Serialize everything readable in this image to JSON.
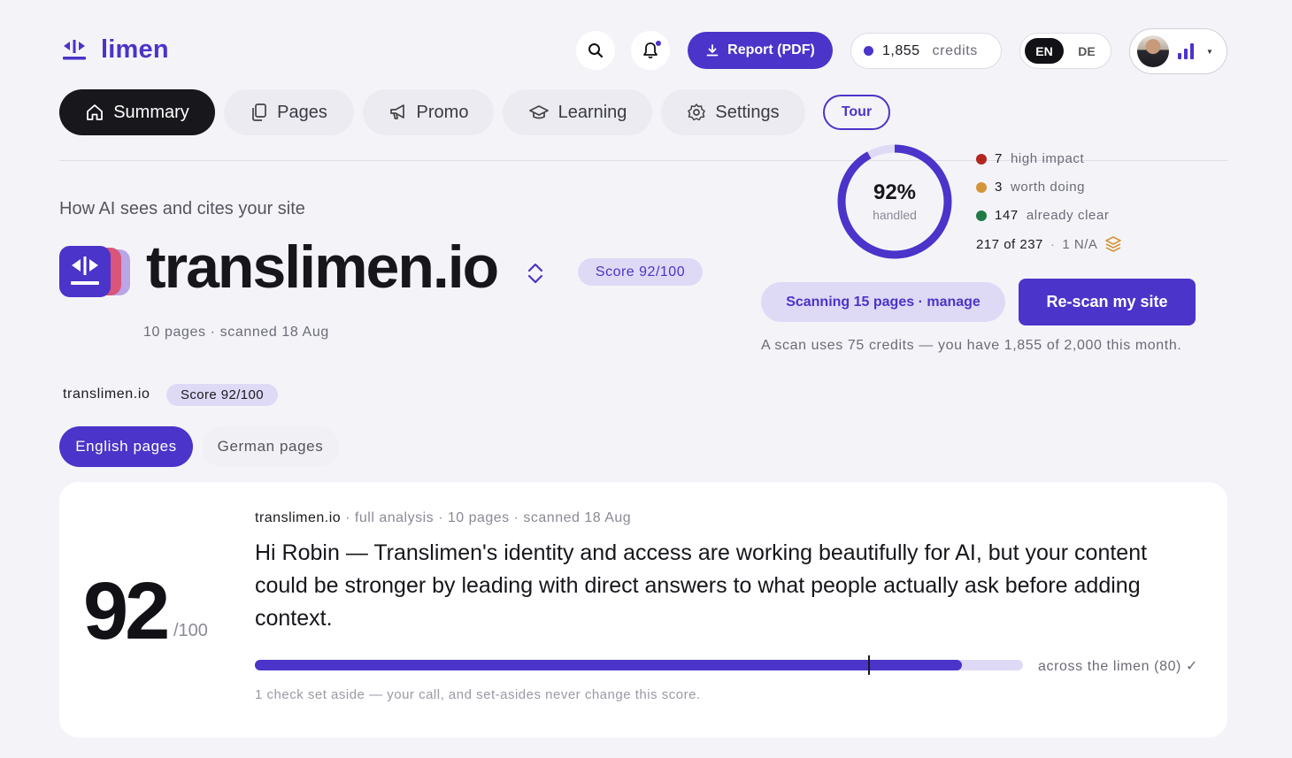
{
  "header": {
    "brand": "limen",
    "report_label": "Report (PDF)",
    "credits": {
      "amount": "1,855",
      "label": "credits"
    },
    "languages": [
      {
        "code": "EN",
        "active": true
      },
      {
        "code": "DE",
        "active": false
      }
    ]
  },
  "tabs": [
    {
      "label": "Summary",
      "icon": "home-icon",
      "active": true
    },
    {
      "label": "Pages",
      "icon": "pages-icon",
      "active": false
    },
    {
      "label": "Promo",
      "icon": "megaphone-icon",
      "active": false
    },
    {
      "label": "Learning",
      "icon": "graduation-cap-icon",
      "active": false
    },
    {
      "label": "Settings",
      "icon": "gear-icon",
      "active": false
    }
  ],
  "tour_label": "Tour",
  "hero": {
    "subtitle": "How AI sees and cites your site",
    "site": "translimen.io",
    "score": "Score 92/100",
    "meta": "10 pages · scanned 18 Aug"
  },
  "status": {
    "handled_percent": 92,
    "handled_text": "92%",
    "handled_label": "handled",
    "legend": [
      {
        "count": "7",
        "label": "high impact",
        "color": "#b3261e"
      },
      {
        "count": "3",
        "label": "worth doing",
        "color": "#d4943a"
      },
      {
        "count": "147",
        "label": "already clear",
        "color": "#1f7a45"
      }
    ],
    "totals": "217 of 237",
    "na": "1 N/A",
    "scan_pill": "Scanning 15 pages · manage",
    "rescan": "Re-scan my site",
    "note": "A scan uses 75 credits — you have 1,855 of 2,000 this month."
  },
  "secondary": {
    "domain": "translimen.io",
    "score": "Score 92/100",
    "lang_tabs": [
      {
        "label": "English pages",
        "active": true
      },
      {
        "label": "German pages",
        "active": false
      }
    ]
  },
  "card": {
    "score": "92",
    "score_of": "/100",
    "meta_domain": "translimen.io",
    "meta_rest": " · full analysis · 10 pages · scanned 18 Aug",
    "message": "Hi Robin — Translimen's identity and access are working beautifully for AI, but your content could be stronger by leading with direct answers to what people actually ask before adding context.",
    "bar_value": 92,
    "benchmark_value": 80,
    "bar_caption": "across the limen (80) ✓",
    "footnote": "1 check set aside — your call, and set-asides never change this score."
  }
}
